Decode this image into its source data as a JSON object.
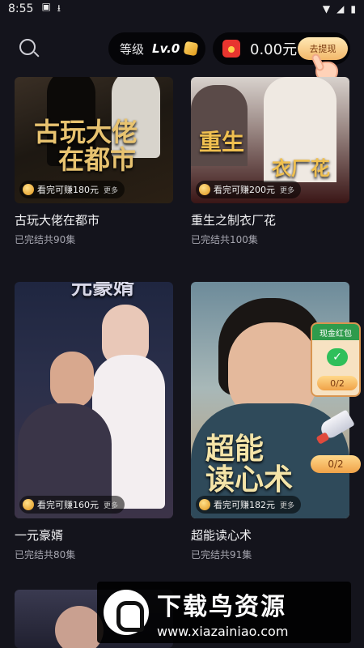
{
  "status_bar": {
    "time": "8:55"
  },
  "header": {
    "level_label": "等级",
    "level_value": "Lv.0",
    "balance": "0.00元",
    "withdraw_label": "去提现"
  },
  "dramas": [
    {
      "title": "古玩大佬在都市",
      "status": "已完结共90集",
      "reward": "看完可赚180元",
      "more": "更多",
      "poster_text": [
        "古玩大佬",
        "在都市"
      ]
    },
    {
      "title": "重生之制衣厂花",
      "status": "已完结共100集",
      "reward": "看完可赚200元",
      "more": "更多",
      "poster_text": [
        "重生",
        "衣厂花"
      ]
    },
    {
      "title": "一元豪婿",
      "status": "已完结共80集",
      "reward": "看完可赚160元",
      "more": "更多",
      "poster_text": [
        "元豪婿"
      ]
    },
    {
      "title": "超能读心术",
      "status": "已完结共91集",
      "reward": "看完可赚182元",
      "more": "更多",
      "poster_text": [
        "超能",
        "读心术"
      ]
    }
  ],
  "float_cash": {
    "label": "现金红包",
    "count": "0/2"
  },
  "float_rocket": {
    "count": "0/2"
  },
  "watermark": {
    "name": "下载鸟资源",
    "url": "www.xiazainiao.com"
  }
}
